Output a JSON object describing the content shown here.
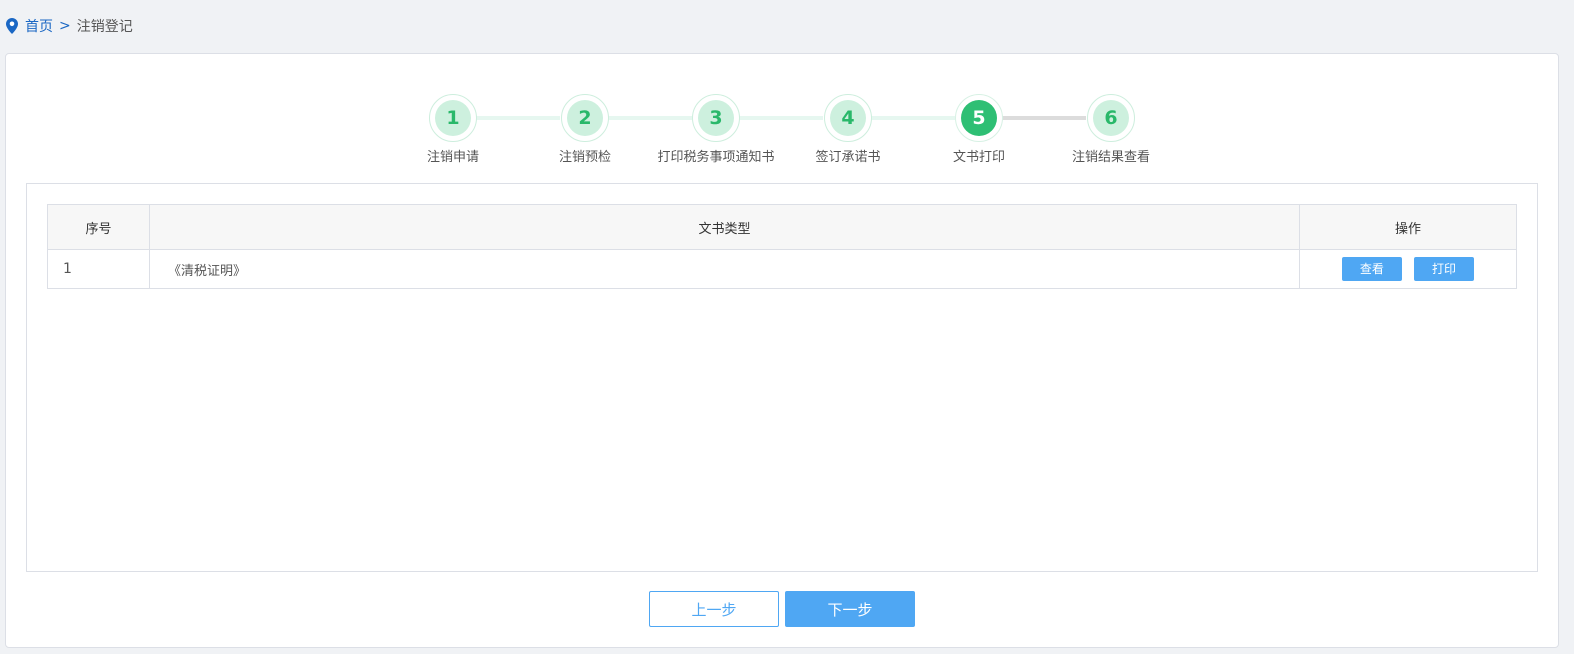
{
  "breadcrumb": {
    "home": "首页",
    "separator": ">",
    "current": "注销登记"
  },
  "steps": [
    {
      "number": "1",
      "label": "注销申请",
      "state": "done"
    },
    {
      "number": "2",
      "label": "注销预检",
      "state": "done"
    },
    {
      "number": "3",
      "label": "打印税务事项通知书",
      "state": "done"
    },
    {
      "number": "4",
      "label": "签订承诺书",
      "state": "done"
    },
    {
      "number": "5",
      "label": "文书打印",
      "state": "current"
    },
    {
      "number": "6",
      "label": "注销结果查看",
      "state": "pending"
    }
  ],
  "table": {
    "headers": {
      "index": "序号",
      "doc_type": "文书类型",
      "operation": "操作"
    },
    "rows": [
      {
        "index": "1",
        "doc_type": "《清税证明》",
        "view_label": "查看",
        "print_label": "打印"
      }
    ]
  },
  "footer": {
    "prev_label": "上一步",
    "next_label": "下一步"
  },
  "colors": {
    "accent": "#4fa7f3",
    "step_active": "#2ebf74",
    "step_done_bg": "#cdf0de",
    "link": "#1a67c4"
  },
  "icons": {
    "breadcrumb_icon": "location-pin-icon"
  }
}
